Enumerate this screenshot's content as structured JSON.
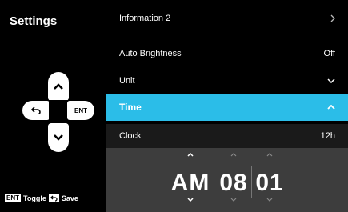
{
  "sidebar": {
    "title": "Settings"
  },
  "dpad": {
    "enter_label": "ENT"
  },
  "footer": {
    "ent_key": "ENT",
    "toggle_label": "Toggle",
    "save_label": "Save"
  },
  "menu": {
    "info": {
      "label": "Information 2"
    },
    "auto_brightness": {
      "label": "Auto Brightness",
      "value": "Off"
    },
    "unit": {
      "label": "Unit"
    },
    "time": {
      "label": "Time"
    },
    "clock": {
      "label": "Clock",
      "value": "12h"
    }
  },
  "time_picker": {
    "ampm": "AM",
    "hour": "08",
    "minute": "01"
  },
  "colors": {
    "accent": "#2bbde8",
    "picker_bg": "#3d3d3d",
    "clock_row_bg": "#1a1a1a"
  }
}
